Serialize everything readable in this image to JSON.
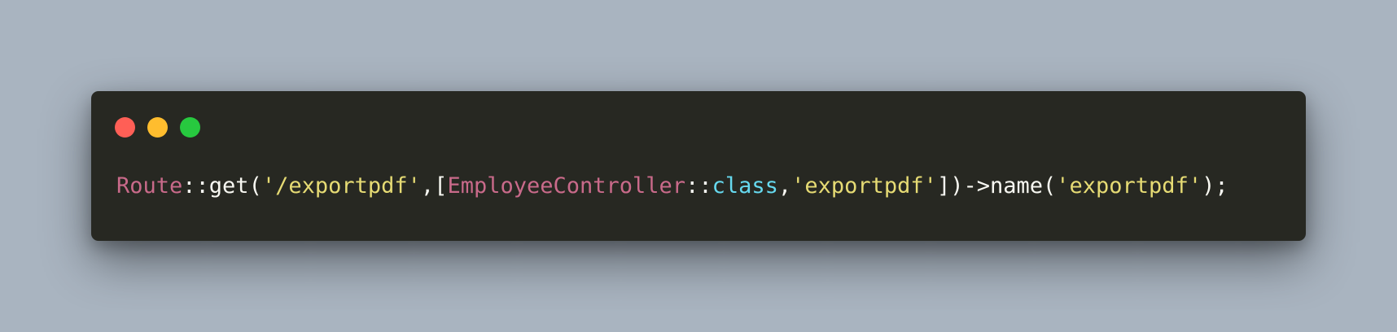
{
  "window": {
    "controls": [
      {
        "name": "close",
        "color": "#ff5f56"
      },
      {
        "name": "minimize",
        "color": "#ffbd2e"
      },
      {
        "name": "maximize",
        "color": "#27c93f"
      }
    ]
  },
  "code": {
    "tokens": [
      {
        "text": "Route",
        "color": "#c96a8a"
      },
      {
        "text": "::",
        "color": "#f8f8f2"
      },
      {
        "text": "get",
        "color": "#f8f8f2"
      },
      {
        "text": "(",
        "color": "#f8f8f2"
      },
      {
        "text": "'/exportpdf'",
        "color": "#e6db74"
      },
      {
        "text": ",",
        "color": "#f8f8f2"
      },
      {
        "text": "[",
        "color": "#f8f8f2"
      },
      {
        "text": "EmployeeController",
        "color": "#c96a8a"
      },
      {
        "text": "::",
        "color": "#f8f8f2"
      },
      {
        "text": "class",
        "color": "#66d9ef"
      },
      {
        "text": ",",
        "color": "#f8f8f2"
      },
      {
        "text": "'exportpdf'",
        "color": "#e6db74"
      },
      {
        "text": "])->",
        "color": "#f8f8f2"
      },
      {
        "text": "name",
        "color": "#f8f8f2"
      },
      {
        "text": "(",
        "color": "#f8f8f2"
      },
      {
        "text": "'exportpdf'",
        "color": "#e6db74"
      },
      {
        "text": ");",
        "color": "#f8f8f2"
      }
    ]
  }
}
